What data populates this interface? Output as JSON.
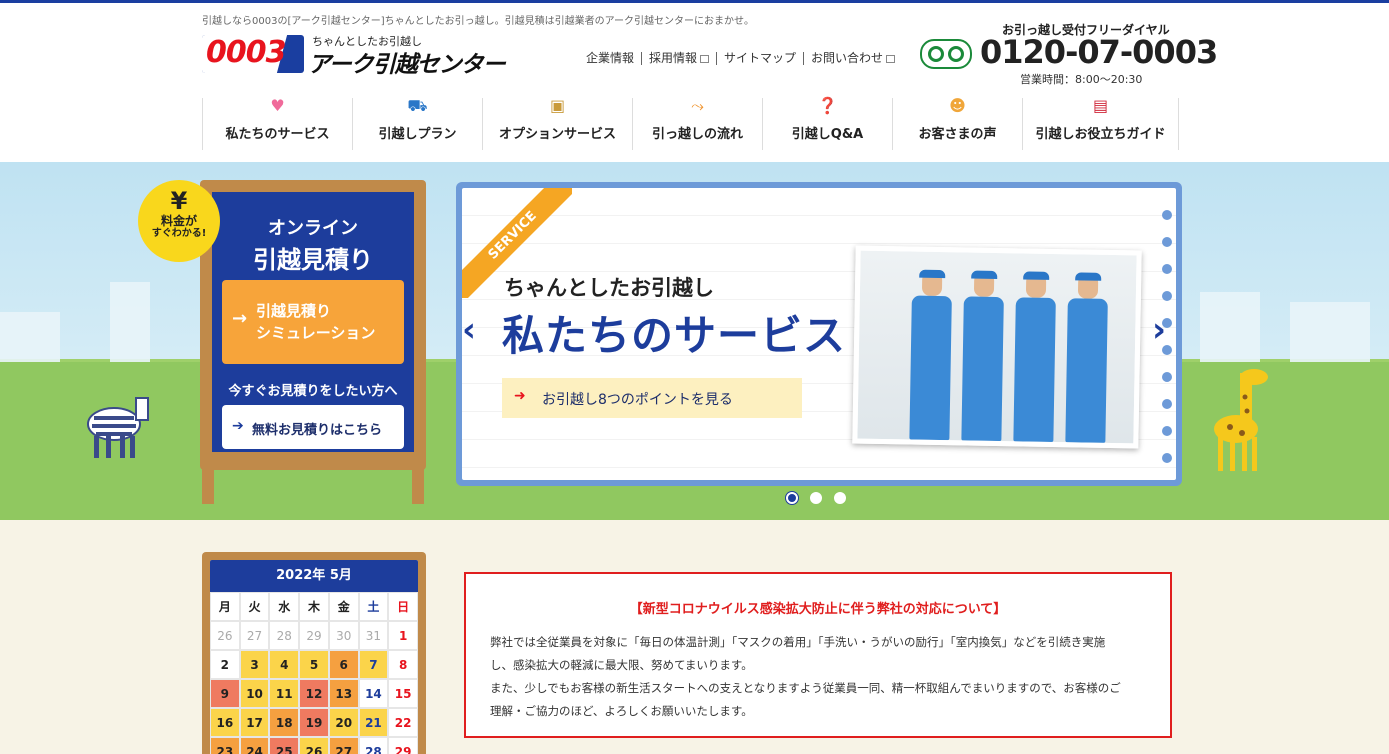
{
  "header": {
    "tagline": "引越しなら0003の[アーク引越センター]ちゃんとしたお引っ越し。引越見積は引越業者のアーク引越センターにおまかせ。",
    "logo_number": "0003",
    "logo_sub": "ちゃんとしたお引越し",
    "logo_name": "アーク引越センター",
    "util_links": [
      "企業情報",
      "採用情報",
      "サイトマップ",
      "お問い合わせ"
    ],
    "phone_label": "お引っ越し受付フリーダイヤル",
    "phone_number": "0120-07-0003",
    "hours": "営業時間：8:00〜20:30"
  },
  "nav": [
    {
      "label": "私たちのサービス",
      "icon": "heart-icon"
    },
    {
      "label": "引越しプラン",
      "icon": "truck-icon"
    },
    {
      "label": "オプションサービス",
      "icon": "box-icon"
    },
    {
      "label": "引っ越しの流れ",
      "icon": "flow-arrow-icon"
    },
    {
      "label": "引越しQ&A",
      "icon": "question-icon"
    },
    {
      "label": "お客さまの声",
      "icon": "people-icon"
    },
    {
      "label": "引越しお役立ちガイド",
      "icon": "book-icon"
    }
  ],
  "board": {
    "badge_yen": "¥",
    "badge_line1": "料金が",
    "badge_line2": "すぐわかる!",
    "title1": "オンライン",
    "title2": "引越見積り",
    "sim_line1": "引越見積り",
    "sim_line2": "シミュレーション",
    "now_text": "今すぐお見積りをしたい方へ",
    "free_text": "無料お見積りはこちら"
  },
  "slide": {
    "ribbon": "SERVICE",
    "subtitle": "ちゃんとしたお引越し",
    "title": "私たちのサービス",
    "button": "お引越し8つのポイントを見る",
    "dots": 3,
    "active_dot": 0
  },
  "calendar": {
    "title": "2022年 5月",
    "weekdays": [
      "月",
      "火",
      "水",
      "木",
      "金",
      "土",
      "日"
    ],
    "rows": [
      [
        "26",
        "27",
        "28",
        "29",
        "30",
        "31",
        "1"
      ],
      [
        "2",
        "3",
        "4",
        "5",
        "6",
        "7",
        "8"
      ],
      [
        "9",
        "10",
        "11",
        "12",
        "13",
        "14",
        "15"
      ],
      [
        "16",
        "17",
        "18",
        "19",
        "20",
        "21",
        "22"
      ],
      [
        "23",
        "24",
        "25",
        "26",
        "27",
        "28",
        "29"
      ]
    ],
    "cell_colors": [
      [
        "#ffffff",
        "#ffffff",
        "#ffffff",
        "#ffffff",
        "#ffffff",
        "#ffffff",
        "#ffffff"
      ],
      [
        "#ffffff",
        "#fbd44a",
        "#fbd44a",
        "#fbd44a",
        "#f5a040",
        "#fbd44a",
        "#ffffff"
      ],
      [
        "#ef7a60",
        "#fbd44a",
        "#fbd44a",
        "#ef7a60",
        "#f5a040",
        "#ffffff",
        "#ffffff"
      ],
      [
        "#fbd44a",
        "#fbd44a",
        "#f5a040",
        "#ef7a60",
        "#fbd44a",
        "#fbd44a",
        "#ffffff"
      ],
      [
        "#f5a040",
        "#f5a040",
        "#ef7a60",
        "#fbd44a",
        "#f5a040",
        "#ffffff",
        "#ffffff"
      ]
    ]
  },
  "notice": {
    "title": "【新型コロナウイルス感染拡大防止に伴う弊社の対応について】",
    "line1": "弊社では全従業員を対象に「毎日の体温計測」「マスクの着用」「手洗い・うがいの励行」「室内換気」などを引続き実施",
    "line2": "し、感染拡大の軽減に最大限、努めてまいります。",
    "line3": "また、少しでもお客様の新生活スタートへの支えとなりますよう従業員一同、精一杯取組んでまいりますので、お客様のご",
    "line4": "理解・ご協力のほど、よろしくお願いいたします。"
  }
}
